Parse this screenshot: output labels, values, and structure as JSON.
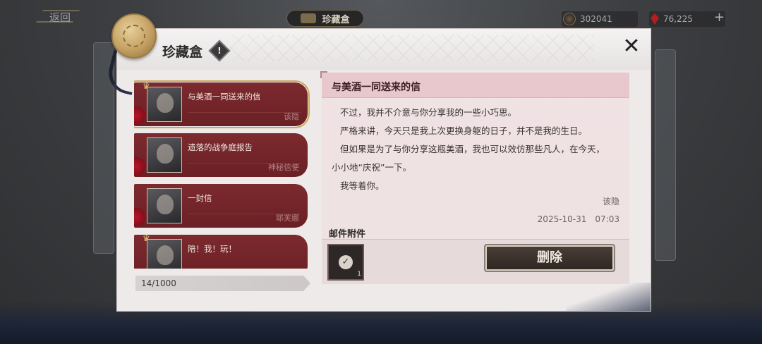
{
  "topbar": {
    "back_label": "返回",
    "screen_title": "珍藏盒",
    "currency_1": "302041",
    "currency_2": "76,225",
    "plus": "+"
  },
  "modal": {
    "title": "珍藏盒",
    "info_icon": "!",
    "close": "✕"
  },
  "mails": [
    {
      "subject": "与美酒一同送来的信",
      "sender": "该隐"
    },
    {
      "subject": "遗落的战争庭报告",
      "sender": "神秘信使"
    },
    {
      "subject": "一封信",
      "sender": "耶芙娜"
    },
    {
      "subject": "陪！我！玩！",
      "sender": ""
    }
  ],
  "mail_count": "14/1000",
  "letter": {
    "subject": "与美酒一同送来的信",
    "paragraphs": [
      "不过，我并不介意与你分享我的一些小巧思。",
      "严格来讲，今天只是我上次更换身躯的日子，并不是我的生日。",
      "但如果是为了与你分享这瓶美酒，我也可以效仿那些凡人，在今天，",
      "小小地“庆祝”一下。",
      "我等着你。"
    ],
    "signature": "该隐",
    "date": "2025-10-31　07:03",
    "attachment_label": "邮件附件",
    "attachment_check": "✓",
    "attachment_qty": "1",
    "delete_label": "删除"
  },
  "colors": {
    "mail_item": "#7c2a2e",
    "accent_gold": "#c9a85a",
    "letter_head": "#e8c8cc"
  }
}
